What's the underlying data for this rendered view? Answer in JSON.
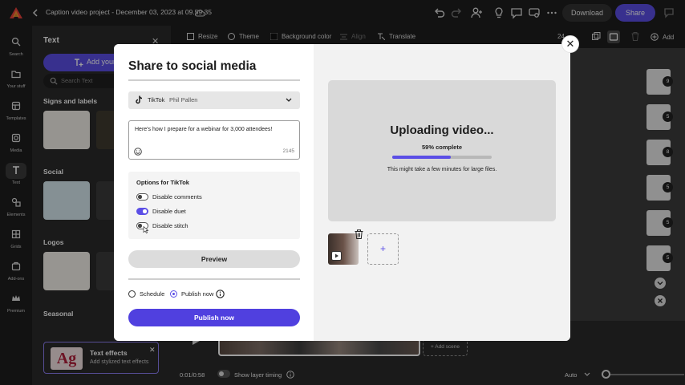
{
  "app": {
    "document_title": "Caption video project - December 03, 2023 at 09.59.35"
  },
  "topbar": {
    "download_label": "Download",
    "share_label": "Share"
  },
  "rail": {
    "items": [
      {
        "label": "Search",
        "icon": "search-icon"
      },
      {
        "label": "Your stuff",
        "icon": "folder-icon"
      },
      {
        "label": "Templates",
        "icon": "templates-icon"
      },
      {
        "label": "Media",
        "icon": "media-icon"
      },
      {
        "label": "Text",
        "icon": "text-icon"
      },
      {
        "label": "Elements",
        "icon": "elements-icon"
      },
      {
        "label": "Grids",
        "icon": "grid-icon"
      },
      {
        "label": "Add-ons",
        "icon": "addons-icon"
      },
      {
        "label": "Premium",
        "icon": "crown-icon"
      }
    ]
  },
  "panel": {
    "title": "Text",
    "add_text_label": "Add your",
    "search_placeholder": "Search Text",
    "sections": [
      "Signs and labels",
      "Social",
      "Logos",
      "Seasonal"
    ],
    "effects_card": {
      "title": "Text effects",
      "subtitle": "Add stylized text effects",
      "preview": "Ag"
    }
  },
  "canvas_toolbar": {
    "resize": "Resize",
    "theme": "Theme",
    "background_color": "Background color",
    "align": "Align",
    "translate": "Translate",
    "add": "Add",
    "zoom_fragment": "24"
  },
  "scenes": {
    "numbers": [
      "9",
      "5",
      "8",
      "5",
      "5",
      "5"
    ]
  },
  "timeline": {
    "time": "0:01/0:58",
    "layer_timing_label": "Show layer timing",
    "zoom_mode": "Auto",
    "add_scene_label": "+ Add scene"
  },
  "modal": {
    "title": "Share to social media",
    "account": {
      "platform": "TikTok",
      "name": "Phil Pallen"
    },
    "caption": {
      "text": "Here's how I prepare for a webinar for 3,000 attendees!",
      "char_count": "2145"
    },
    "options": {
      "title": "Options for TikTok",
      "items": [
        {
          "label": "Disable comments",
          "on": false
        },
        {
          "label": "Disable duet",
          "on": true
        },
        {
          "label": "Disable stitch",
          "on": false
        }
      ]
    },
    "preview_label": "Preview",
    "schedule_label": "Schedule",
    "publish_now_radio_label": "Publish now",
    "publish_button_label": "Publish now",
    "upload": {
      "title": "Uploading video...",
      "percent_text": "59% complete",
      "progress": 0.59,
      "note": "This might take a few minutes for large files."
    },
    "add_media_symbol": "+"
  },
  "colors": {
    "accent": "#5b4ee6",
    "modal_bg": "#ffffff",
    "upload_card_bg": "#d9d9d9"
  }
}
